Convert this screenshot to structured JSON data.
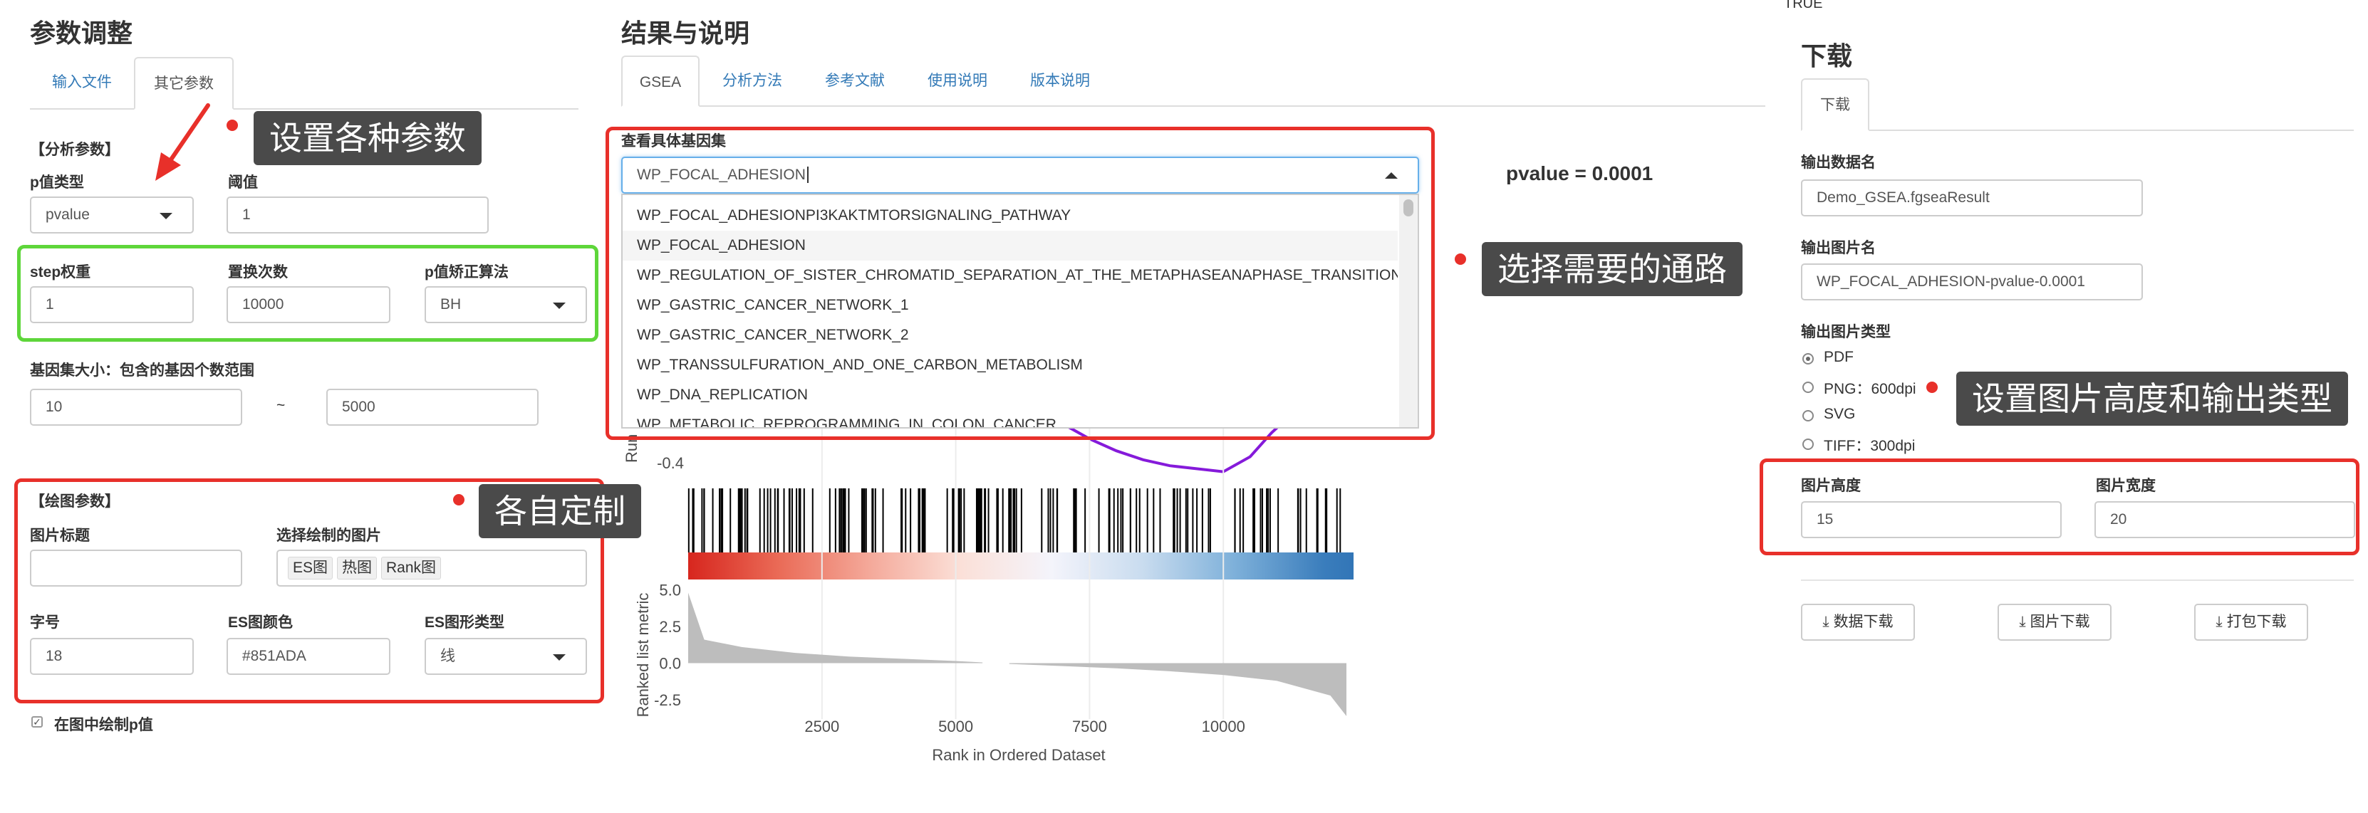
{
  "top_right_text": "TRUE",
  "left": {
    "title": "参数调整",
    "tabs": [
      {
        "label": "输入文件"
      },
      {
        "label": "其它参数"
      }
    ],
    "analysis": {
      "heading": "【分析参数】",
      "ptype_label": "p值类型",
      "ptype_value": "pvalue",
      "threshold_label": "阈值",
      "threshold_value": "1",
      "step_label": "step权重",
      "step_value": "1",
      "nperm_label": "置换次数",
      "nperm_value": "10000",
      "padj_label": "p值矫正算法",
      "padj_value": "BH",
      "size_label": "基因集大小：包含的基因个数范围",
      "size_min": "10",
      "size_sep": "~",
      "size_max": "5000"
    },
    "plot": {
      "heading": "【绘图参数】",
      "title_label": "图片标题",
      "title_value": "",
      "choose_label": "选择绘制的图片",
      "choose_tags": [
        "ES图",
        "热图",
        "Rank图"
      ],
      "font_label": "字号",
      "font_value": "18",
      "color_label": "ES图颜色",
      "color_value": "#851ADA",
      "shape_label": "ES图形类型",
      "shape_value": "线",
      "draw_p_label": "在图中绘制p值"
    }
  },
  "middle": {
    "title": "结果与说明",
    "tabs": [
      {
        "label": "GSEA"
      },
      {
        "label": "分析方法"
      },
      {
        "label": "参考文献"
      },
      {
        "label": "使用说明"
      },
      {
        "label": "版本说明"
      }
    ],
    "geneset_label": "查看具体基因集",
    "geneset_value": "WP_FOCAL_ADHESION",
    "dropdown_items": [
      "WP_FOCAL_ADHESIONPI3KAKTMTORSIGNALING_PATHWAY",
      "WP_FOCAL_ADHESION",
      "WP_REGULATION_OF_SISTER_CHROMATID_SEPARATION_AT_THE_METAPHASEANAPHASE_TRANSITION",
      "WP_GASTRIC_CANCER_NETWORK_1",
      "WP_GASTRIC_CANCER_NETWORK_2",
      "WP_TRANSSULFURATION_AND_ONE_CARBON_METABOLISM",
      "WP_DNA_REPLICATION",
      "WP_METABOLIC_REPROGRAMMING_IN_COLON_CANCER"
    ],
    "pvalue_text": "pvalue = 0.0001"
  },
  "chart_data": {
    "type": "line",
    "title": "",
    "xlabel": "Rank in Ordered Dataset",
    "x_ticks": [
      2500,
      5000,
      7500,
      10000
    ],
    "xlim": [
      0,
      12300
    ],
    "es_ylabel": "Run",
    "es_y_ticks": [
      -0.4
    ],
    "es_color": "#851ADA",
    "es_curve": {
      "x": [
        6500,
        7000,
        7500,
        8000,
        8500,
        9000,
        9500,
        10000,
        10500,
        10900,
        11200
      ],
      "y": [
        -0.2,
        -0.27,
        -0.32,
        -0.36,
        -0.39,
        -0.41,
        -0.42,
        -0.43,
        -0.38,
        -0.3,
        -0.25
      ]
    },
    "ranked_ylabel": "Ranked list metric",
    "ranked_y_ticks": [
      5.0,
      2.5,
      0.0,
      -2.5
    ],
    "ranked_ylim": [
      -3.8,
      5.5
    ],
    "ranked_profile": {
      "x": [
        0,
        300,
        1000,
        2000,
        3000,
        4000,
        5000,
        5500,
        6000,
        7000,
        8000,
        9000,
        10000,
        11000,
        12000,
        12300
      ],
      "y": [
        4.8,
        1.6,
        1.1,
        0.7,
        0.45,
        0.3,
        0.15,
        0.05,
        -0.05,
        -0.2,
        -0.35,
        -0.55,
        -0.8,
        -1.2,
        -2.2,
        -3.6
      ]
    },
    "gap_range": [
      5500,
      6000
    ],
    "heat_gradient": [
      "#d7261e",
      "#ea6b57",
      "#f4a99a",
      "#fbe0d8",
      "#f4f4fb",
      "#c9dcef",
      "#7fb1da",
      "#3a7dbc",
      "#2166ac"
    ]
  },
  "right": {
    "title": "下载",
    "tab": "下载",
    "dataname_label": "输出数据名",
    "dataname_value": "Demo_GSEA.fgseaResult",
    "imgname_label": "输出图片名",
    "imgname_value": "WP_FOCAL_ADHESION-pvalue-0.0001",
    "imgtype_label": "输出图片类型",
    "imgtype_options": [
      "PDF",
      "PNG：600dpi",
      "SVG",
      "TIFF：300dpi"
    ],
    "height_label": "图片高度",
    "height_value": "15",
    "width_label": "图片宽度",
    "width_value": "20",
    "buttons": [
      "数据下载",
      "图片下载",
      "打包下载"
    ]
  },
  "callouts": {
    "params": "设置各种参数",
    "custom": "各自定制",
    "pathway": "选择需要的通路",
    "size_type": "设置图片高度和输出类型"
  }
}
